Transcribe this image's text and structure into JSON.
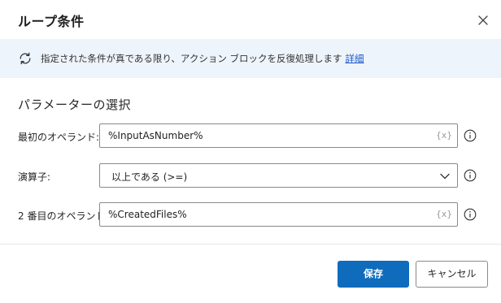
{
  "dialog": {
    "title": "ループ条件",
    "close_icon": "close-icon"
  },
  "info": {
    "icon": "loop-icon",
    "text": "指定された条件が真である限り、アクション ブロックを反復処理します",
    "link": "詳細"
  },
  "section": {
    "title": "パラメーターの選択"
  },
  "fields": {
    "first_operand": {
      "label": "最初のオペランド:",
      "value": "%InputAsNumber%",
      "var_button": "{x}"
    },
    "operator": {
      "label": "演算子:",
      "value": "以上である (>=)"
    },
    "second_operand": {
      "label": "2 番目のオペランド:",
      "value": "%CreatedFiles%",
      "var_button": "{x}"
    }
  },
  "buttons": {
    "save": "保存",
    "cancel": "キャンセル"
  },
  "colors": {
    "accent": "#0f6cbd",
    "banner_bg": "#eef4fb",
    "link": "#1a55c8"
  }
}
